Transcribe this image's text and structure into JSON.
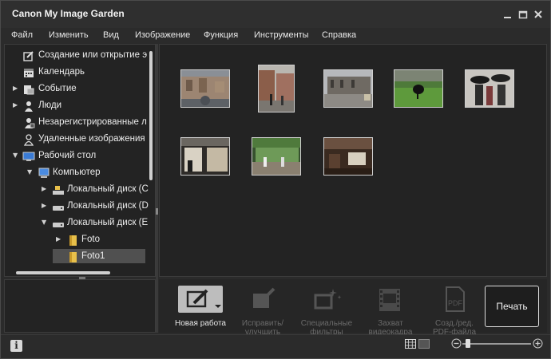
{
  "window": {
    "title": "Canon My Image Garden"
  },
  "menu": {
    "items": [
      "Файл",
      "Изменить",
      "Вид",
      "Изображение",
      "Функция",
      "Инструменты",
      "Справка"
    ]
  },
  "tree": {
    "items": [
      {
        "label": "Создание или открытие э",
        "icon": "create-open-icon",
        "expanded": null
      },
      {
        "label": "Календарь",
        "icon": "calendar-icon",
        "expanded": null
      },
      {
        "label": "Событие",
        "icon": "event-icon",
        "expanded": false
      },
      {
        "label": "Люди",
        "icon": "people-icon",
        "expanded": false
      },
      {
        "label": "Незарегистрированные л",
        "icon": "unregistered-people-icon",
        "expanded": null
      },
      {
        "label": "Удаленные изображения",
        "icon": "deleted-images-icon",
        "expanded": null
      },
      {
        "label": "Рабочий стол",
        "icon": "desktop-icon",
        "expanded": true
      },
      {
        "label": "Компьютер",
        "icon": "computer-icon",
        "expanded": true
      },
      {
        "label": "Локальный диск (C",
        "icon": "system-drive-icon",
        "expanded": false
      },
      {
        "label": "Локальный диск (D",
        "icon": "drive-icon",
        "expanded": false
      },
      {
        "label": "Локальный диск (E",
        "icon": "drive-icon",
        "expanded": true
      },
      {
        "label": "Foto",
        "icon": "folder-icon",
        "expanded": false
      },
      {
        "label": "Foto1",
        "icon": "folder-icon",
        "expanded": null,
        "selected": true
      }
    ]
  },
  "thumbnails": [
    {
      "name": "photo-1",
      "scene": "square-buildings"
    },
    {
      "name": "photo-2",
      "scene": "street-tall"
    },
    {
      "name": "photo-3",
      "scene": "square-wide"
    },
    {
      "name": "photo-4",
      "scene": "grass-bird"
    },
    {
      "name": "photo-5",
      "scene": "people-umbrellas"
    },
    {
      "name": "photo-6",
      "scene": "shop-front"
    },
    {
      "name": "photo-7",
      "scene": "cafe-green"
    },
    {
      "name": "photo-8",
      "scene": "cafe-interior"
    }
  ],
  "toolbar": {
    "new_work": {
      "label": "Новая работа"
    },
    "fix_enhance": {
      "line1": "Исправить/",
      "line2": "улучшить"
    },
    "special_filters": {
      "line1": "Специальные",
      "line2": "фильтры"
    },
    "video_capture": {
      "line1": "Захват",
      "line2": "видеокадра"
    },
    "create_pdf": {
      "line1": "Созд./ред.",
      "line2": "PDF-файла",
      "icon_text": "PDF"
    },
    "print": {
      "label": "Печать"
    }
  },
  "status": {
    "info_icon_text": "i",
    "zoom_level": 0.05
  },
  "colors": {
    "background": "#2b2b2b",
    "panel": "#232323",
    "selected": "#505050",
    "text": "#e6e6e6",
    "disabled_text": "#6a6a6a",
    "folder": "#e8c04a"
  }
}
